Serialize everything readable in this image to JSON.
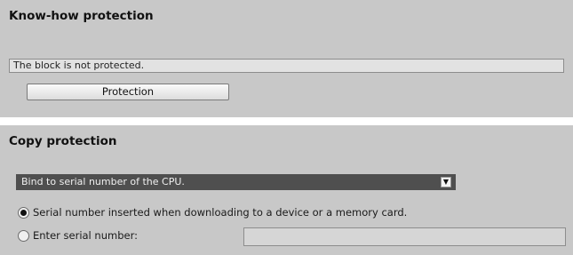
{
  "knowhow": {
    "title": "Know-how protection",
    "status": "The block is not protected.",
    "protection_button": "Protection"
  },
  "copy": {
    "title": "Copy protection",
    "binding_select": "Bind to serial number of the CPU.",
    "radio_options": [
      {
        "label": "Serial number inserted when downloading to a device or a memory card.",
        "selected": true
      },
      {
        "label": "Enter serial number:",
        "selected": false
      }
    ],
    "serial_input_value": ""
  },
  "colors": {
    "panel_bg": "#c8c8c8",
    "select_bg": "#4f4f4f"
  }
}
